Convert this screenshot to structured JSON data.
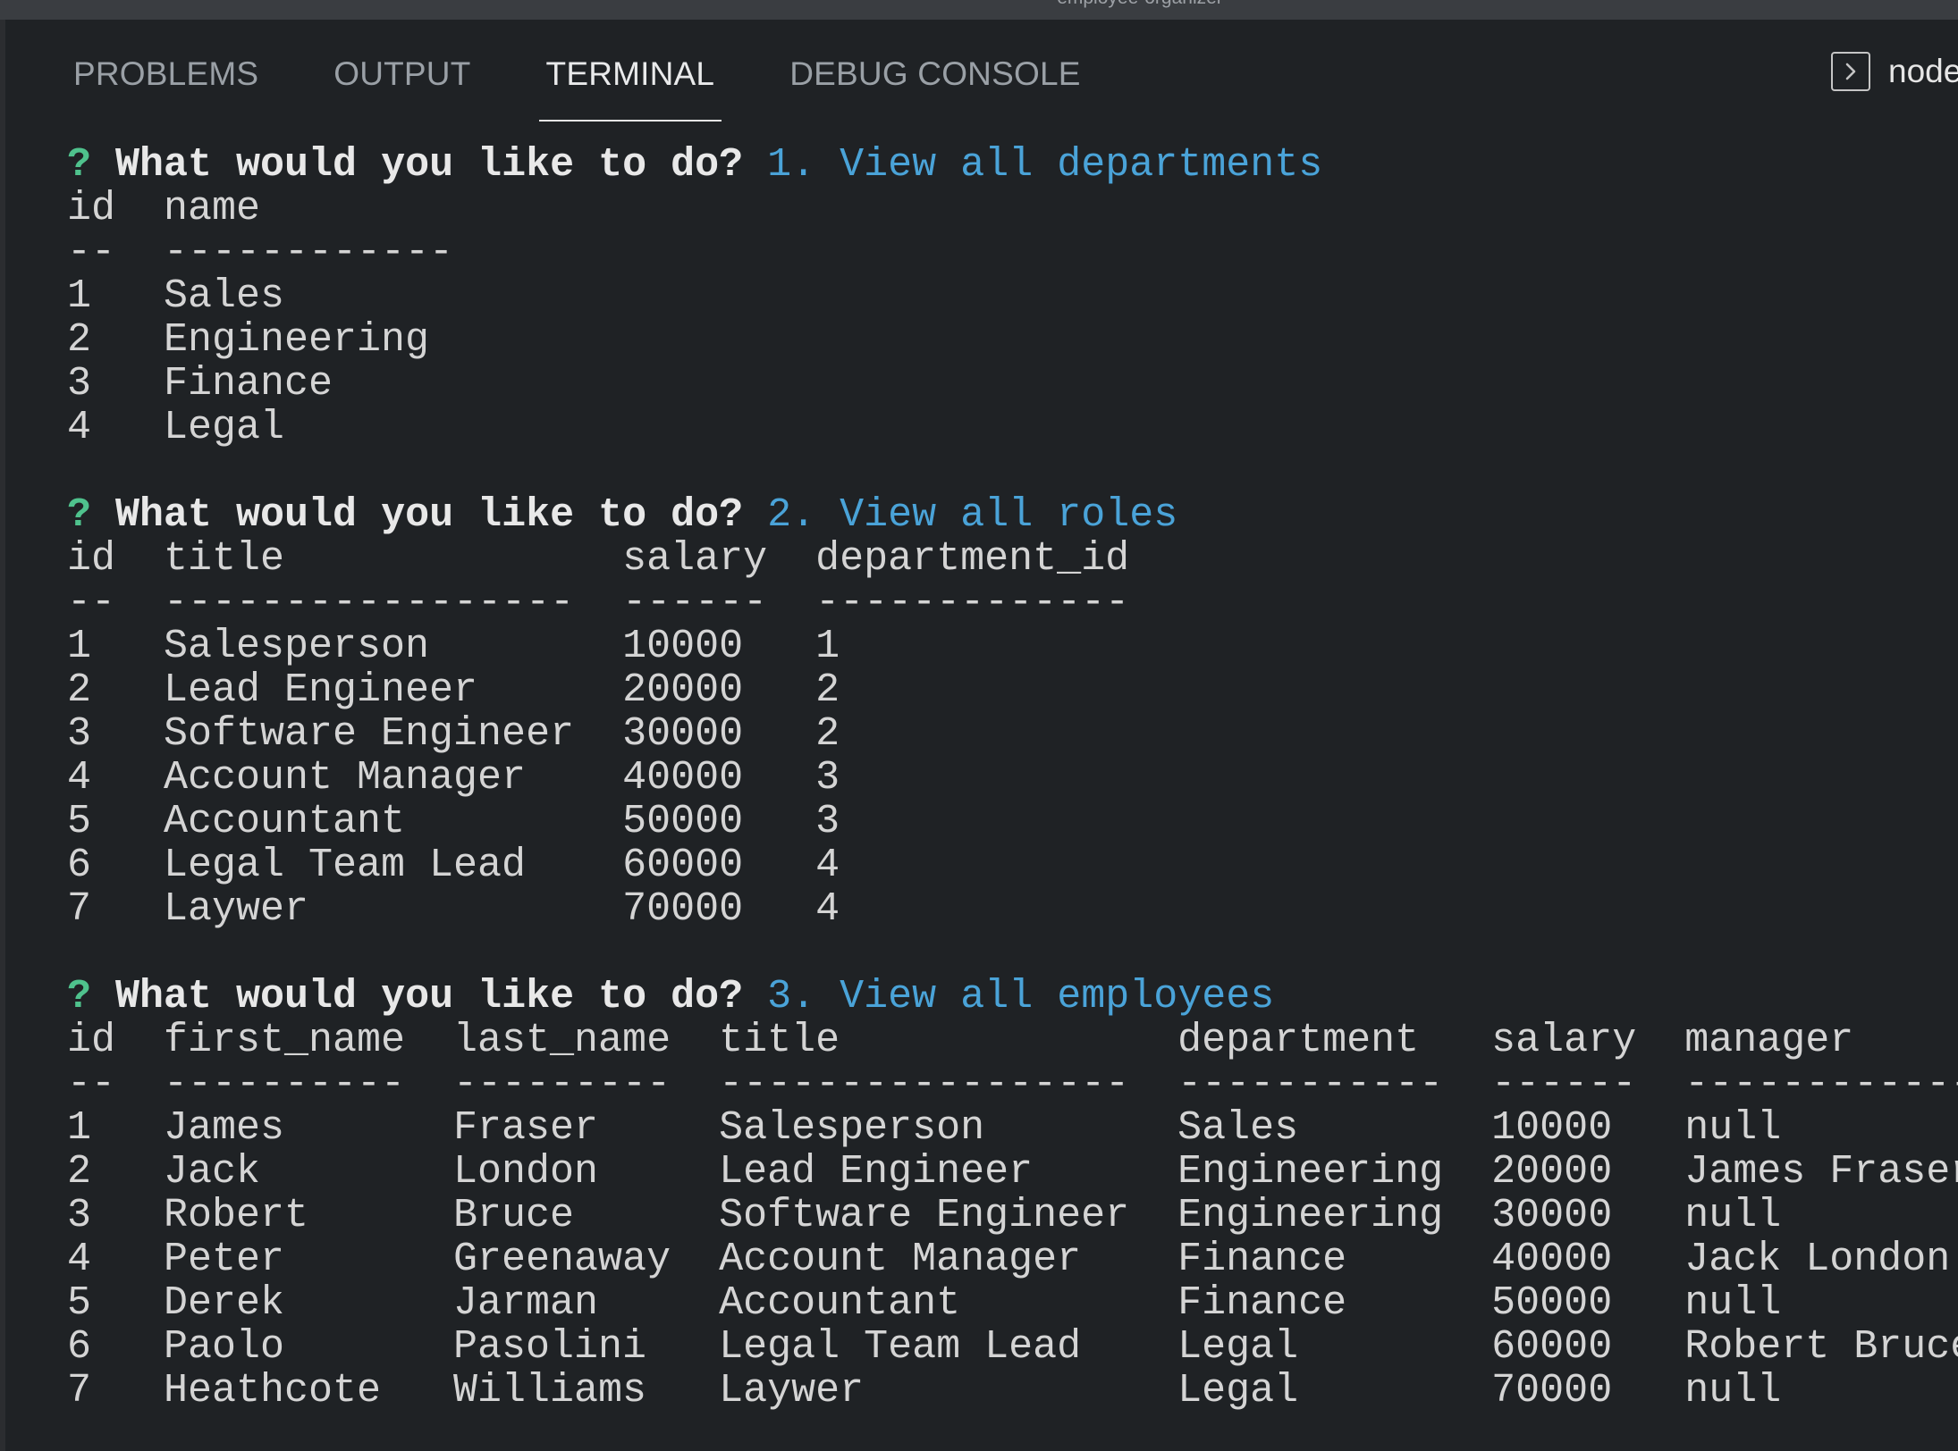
{
  "window": {
    "title": "employee-organizer"
  },
  "panel": {
    "tabs": [
      {
        "label": "PROBLEMS"
      },
      {
        "label": "OUTPUT"
      },
      {
        "label": "TERMINAL"
      },
      {
        "label": "DEBUG CONSOLE"
      }
    ],
    "terminal_selector": "node"
  },
  "sections": [
    {
      "question": "What would you like to do?",
      "answer": "1. View all departments",
      "columns": [
        "id",
        "name"
      ],
      "widths": [
        2,
        12
      ],
      "rows": [
        [
          "1",
          "Sales"
        ],
        [
          "2",
          "Engineering"
        ],
        [
          "3",
          "Finance"
        ],
        [
          "4",
          "Legal"
        ]
      ]
    },
    {
      "question": "What would you like to do?",
      "answer": "2. View all roles",
      "columns": [
        "id",
        "title",
        "salary",
        "department_id"
      ],
      "widths": [
        2,
        17,
        6,
        13
      ],
      "rows": [
        [
          "1",
          "Salesperson",
          "10000",
          "1"
        ],
        [
          "2",
          "Lead Engineer",
          "20000",
          "2"
        ],
        [
          "3",
          "Software Engineer",
          "30000",
          "2"
        ],
        [
          "4",
          "Account Manager",
          "40000",
          "3"
        ],
        [
          "5",
          "Accountant",
          "50000",
          "3"
        ],
        [
          "6",
          "Legal Team Lead",
          "60000",
          "4"
        ],
        [
          "7",
          "Laywer",
          "70000",
          "4"
        ]
      ]
    },
    {
      "question": "What would you like to do?",
      "answer": "3. View all employees",
      "columns": [
        "id",
        "first_name",
        "last_name",
        "title",
        "department",
        "salary",
        "manager"
      ],
      "widths": [
        2,
        10,
        9,
        17,
        11,
        6,
        12
      ],
      "rows": [
        [
          "1",
          "James",
          "Fraser",
          "Salesperson",
          "Sales",
          "10000",
          "null"
        ],
        [
          "2",
          "Jack",
          "London",
          "Lead Engineer",
          "Engineering",
          "20000",
          "James Fraser"
        ],
        [
          "3",
          "Robert",
          "Bruce",
          "Software Engineer",
          "Engineering",
          "30000",
          "null"
        ],
        [
          "4",
          "Peter",
          "Greenaway",
          "Account Manager",
          "Finance",
          "40000",
          "Jack London"
        ],
        [
          "5",
          "Derek",
          "Jarman",
          "Accountant",
          "Finance",
          "50000",
          "null"
        ],
        [
          "6",
          "Paolo",
          "Pasolini",
          "Legal Team Lead",
          "Legal",
          "60000",
          "Robert Bruce"
        ],
        [
          "7",
          "Heathcote",
          "Williams",
          "Laywer",
          "Legal",
          "70000",
          "null"
        ]
      ]
    }
  ]
}
